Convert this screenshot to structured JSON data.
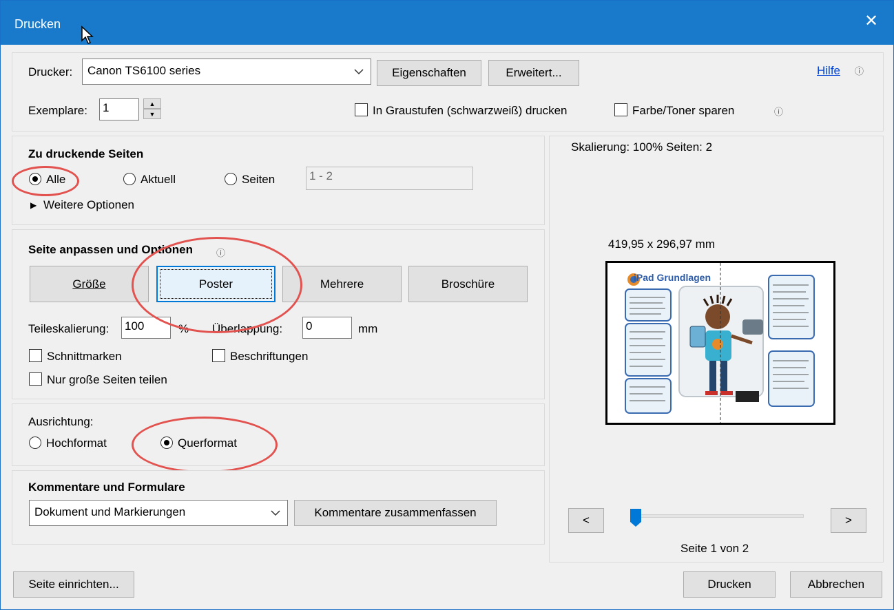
{
  "window": {
    "title": "Drucken",
    "close_glyph": "✕"
  },
  "printer": {
    "label": "Drucker:",
    "selected": "Canon TS6100 series",
    "properties_button": "Eigenschaften",
    "advanced_button": "Erweitert...",
    "help_link": "Hilfe",
    "copies_label": "Exemplare:",
    "copies_value": "1",
    "grayscale_label": "In Graustufen (schwarzweiß) drucken",
    "grayscale_checked": false,
    "save_toner_label": "Farbe/Toner sparen",
    "save_toner_checked": false
  },
  "pages": {
    "heading": "Zu druckende Seiten",
    "all_label": "Alle",
    "current_label": "Aktuell",
    "pages_label": "Seiten",
    "pages_range_value": "1 - 2",
    "selected": "Alle",
    "more_options": "Weitere Optionen"
  },
  "sizing": {
    "heading": "Seite anpassen und Optionen",
    "tabs": [
      "Größe",
      "Poster",
      "Mehrere",
      "Broschüre"
    ],
    "active_tab": "Poster",
    "tile_scale_label": "Teileskalierung:",
    "tile_scale_value": "100",
    "tile_scale_unit": "%",
    "overlap_label": "Überlappung:",
    "overlap_value": "0",
    "overlap_unit": "mm",
    "cut_marks_label": "Schnittmarken",
    "labels_label": "Beschriftungen",
    "tile_large_pages_label": "Nur große Seiten teilen"
  },
  "orientation": {
    "heading": "Ausrichtung:",
    "portrait_label": "Hochformat",
    "landscape_label": "Querformat",
    "selected": "Querformat"
  },
  "comments": {
    "heading": "Kommentare und Formulare",
    "selected": "Dokument und Markierungen",
    "summarize_button": "Kommentare zusammenfassen"
  },
  "preview": {
    "scale_text": "Skalierung: 100% Seiten: 2",
    "dimensions": "419,95 x 296,97 mm",
    "doc_title": "iPad Grundlagen",
    "prev_button": "<",
    "next_button": ">",
    "page_indicator": "Seite 1 von 2"
  },
  "footer": {
    "page_setup_button": "Seite einrichten...",
    "print_button": "Drucken",
    "cancel_button": "Abbrechen"
  },
  "colors": {
    "titlebar": "#1979ca",
    "annotation_ring": "#e2524f",
    "focus_border": "#0078d7",
    "link": "#0645d6"
  }
}
